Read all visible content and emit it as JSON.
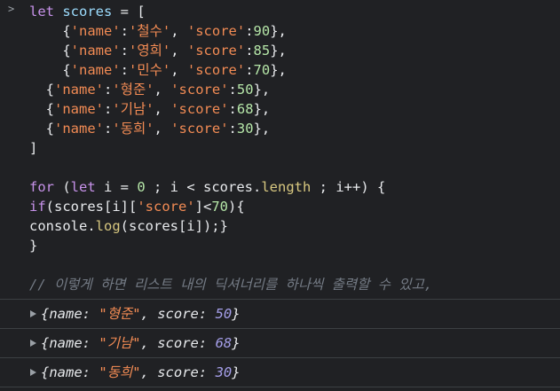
{
  "console": {
    "prompt": ">",
    "code": {
      "line1": {
        "kw": "let",
        "var": "scores",
        "rest": " = ["
      },
      "entries": [
        {
          "indent": "    ",
          "name": "'철수'",
          "score": "90"
        },
        {
          "indent": "    ",
          "name": "'영희'",
          "score": "85"
        },
        {
          "indent": "    ",
          "name": "'민수'",
          "score": "70"
        },
        {
          "indent": "  ",
          "name": "'형준'",
          "score": "50"
        },
        {
          "indent": "  ",
          "name": "'기남'",
          "score": "68"
        },
        {
          "indent": "  ",
          "name": "'동희'",
          "score": "30"
        }
      ],
      "name_key": "'name'",
      "score_key": "'score'",
      "close_bracket": "]",
      "for_kw": "for",
      "let_kw": "let",
      "for_i": " i = ",
      "for_zero": "0",
      "for_mid": " ; i < scores.",
      "for_length": "length",
      "for_end": " ; i++) {",
      "if_kw": "if",
      "if_open": "(scores[i][",
      "if_score": "'score'",
      "if_lt": "]<",
      "if_num": "70",
      "if_close": "){",
      "console_pre": "console.",
      "log_fn": "log",
      "console_post": "(scores[i]);}",
      "close_brace": "}",
      "comment": "// 이렇게 하면 리스트 내의 딕셔너리를 하나씩 출력할 수 있고,"
    },
    "outputs": [
      {
        "name_val": "\"형준\"",
        "score_val": "50"
      },
      {
        "name_val": "\"기남\"",
        "score_val": "68"
      },
      {
        "name_val": "\"동희\"",
        "score_val": "30"
      }
    ],
    "out_name_key": "name:",
    "out_score_key": "score:"
  },
  "colors": {
    "background": "#202124",
    "keyword": "#c792ea",
    "string": "#f28b54",
    "number": "#b5e6a8",
    "property": "#d8c880",
    "output_number": "#a49ee8",
    "comment": "#747b85"
  }
}
